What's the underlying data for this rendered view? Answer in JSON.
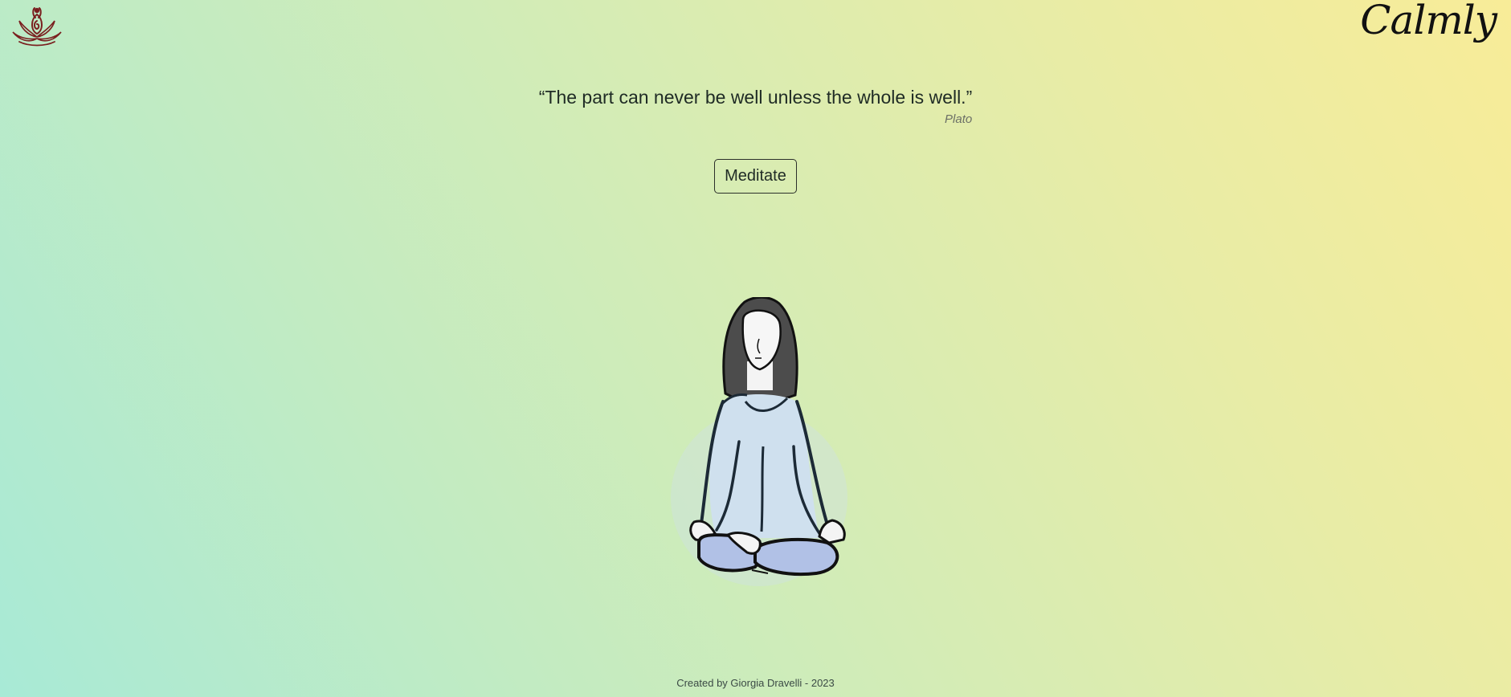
{
  "brand": {
    "name": "Calmly",
    "logo_icon": "lotus-meditation-icon",
    "logo_color": "#7a1f1f"
  },
  "quote": {
    "text": "“The part can never be well unless the whole is well.”",
    "author": "Plato"
  },
  "actions": {
    "meditate_label": "Meditate"
  },
  "illustration": {
    "icon": "meditating-woman-illustration",
    "shirt_color": "#cfe0ee",
    "pants_color": "#b1c1e6",
    "hair_color": "#4c4c4c"
  },
  "footer": {
    "credit": "Created by Giorgia Dravelli - 2023"
  },
  "colors": {
    "gradient_start": "#a8ead6",
    "gradient_end": "#f8ec98"
  }
}
